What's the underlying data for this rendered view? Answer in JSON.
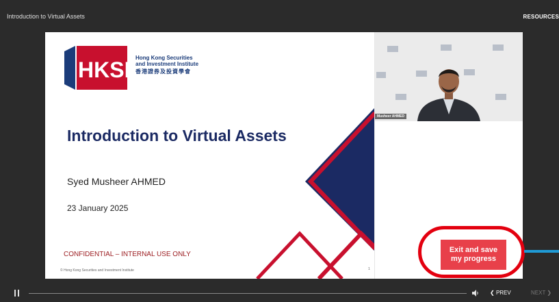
{
  "player": {
    "course_title": "Introduction to Virtual Assets",
    "resources_label": "RESOURCES"
  },
  "slide": {
    "logo": {
      "mark_text": "HKSI",
      "name_en_line1": "Hong Kong Securities",
      "name_en_line2": "and Investment Institute",
      "name_zh": "香港證券及投資學會"
    },
    "title": "Introduction to Virtual Assets",
    "presenter": "Syed Musheer AHMED",
    "date": "23 January 2025",
    "confidential": "CONFIDENTIAL – INTERNAL USE ONLY",
    "copyright": "© Hong Kong Securities and Investment Institute",
    "page_number": "1"
  },
  "webcam": {
    "name_label": "Musheer AHMED"
  },
  "exit_button": {
    "line1": "Exit and save",
    "line2": "my progress"
  },
  "controls": {
    "prev_label": "PREV",
    "next_label": "NEXT",
    "pause_icon": "pause-icon",
    "volume_icon": "volume-icon"
  },
  "colors": {
    "brand_navy": "#1b2a63",
    "brand_red": "#c8102e",
    "exit_button": "#e8404a",
    "highlight": "#e3000f",
    "connector": "#1f9bd6"
  }
}
